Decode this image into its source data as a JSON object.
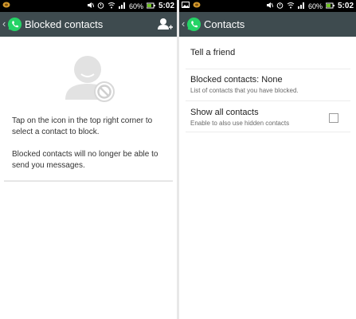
{
  "status": {
    "battery": "60%",
    "time": "5:02"
  },
  "blocked_screen": {
    "title": "Blocked contacts",
    "hint1": "Tap on the icon in the top right corner to select a contact to block.",
    "hint2": "Blocked contacts will no longer be able to send you messages."
  },
  "contacts_screen": {
    "title": "Contacts",
    "tell_friend": "Tell a friend",
    "blocked_label": "Blocked contacts: None",
    "blocked_sub": "List of contacts that you have blocked.",
    "show_all_label": "Show all contacts",
    "show_all_sub": "Enable to also use hidden contacts",
    "show_all_checked": false
  },
  "colors": {
    "appbar": "#3e4b4f",
    "status_bar": "#000000",
    "whatsapp_green": "#25d366"
  },
  "icons": [
    "back-chevron-icon",
    "whatsapp-logo-icon",
    "add-contact-icon",
    "blocked-user-icon",
    "notification-icon",
    "gallery-icon",
    "mute-icon",
    "alarm-icon",
    "wifi-icon",
    "signal-icon",
    "battery-icon"
  ]
}
